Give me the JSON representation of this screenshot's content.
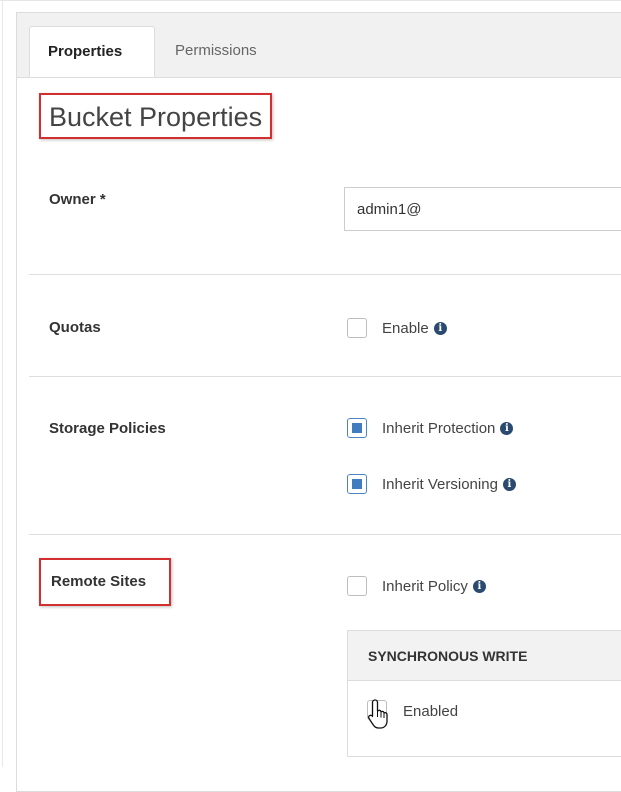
{
  "tabs": [
    {
      "label": "Properties",
      "active": true
    },
    {
      "label": "Permissions",
      "active": false
    }
  ],
  "page_title": "Bucket Properties",
  "owner": {
    "label": "Owner *",
    "value": "admin1@"
  },
  "quotas": {
    "label": "Quotas",
    "enable_label": "Enable",
    "enabled": false
  },
  "storage_policies": {
    "label": "Storage Policies",
    "inherit_protection": {
      "label": "Inherit Protection",
      "checked": true
    },
    "inherit_versioning": {
      "label": "Inherit Versioning",
      "checked": true
    }
  },
  "remote_sites": {
    "label": "Remote Sites",
    "inherit_policy": {
      "label": "Inherit Policy",
      "checked": false
    },
    "sync_write": {
      "header": "SYNCHRONOUS WRITE",
      "enabled_label": "Enabled",
      "enabled": false
    }
  },
  "icons": {
    "info": "info-icon",
    "cursor": "hand-pointer-icon"
  },
  "colors": {
    "highlight": "#d32f2f",
    "checkbox_accent": "#3f7dc0",
    "info_icon": "#2b4a6f"
  }
}
